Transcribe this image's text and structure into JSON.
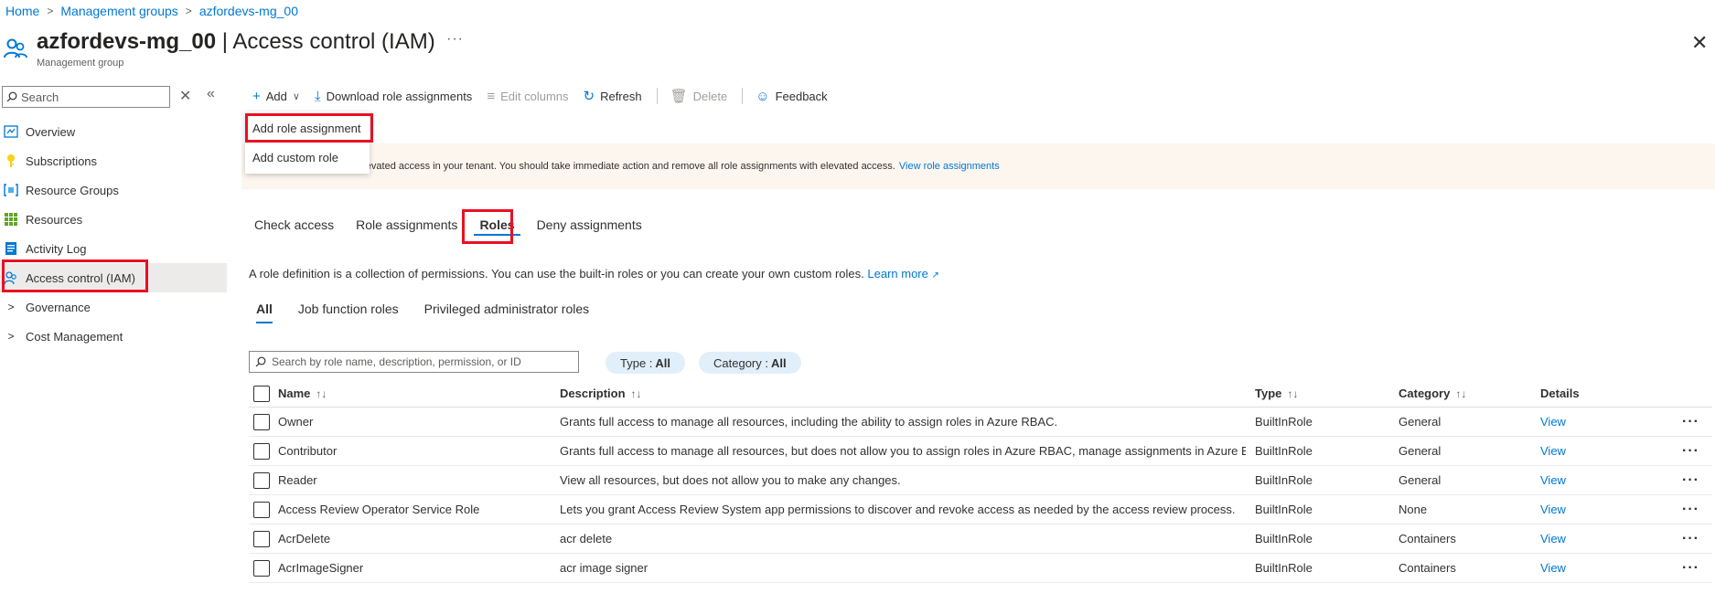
{
  "breadcrumb": {
    "items": [
      "Home",
      "Management groups",
      "azfordevs-mg_00"
    ]
  },
  "header": {
    "title_resource": "azfordevs-mg_00",
    "title_separator": " | ",
    "title_page": "Access control (IAM)",
    "subtitle": "Management group",
    "more": "···",
    "close": "✕"
  },
  "sidebar": {
    "search_placeholder": "Search",
    "items": [
      {
        "label": "Overview",
        "icon": "overview-icon"
      },
      {
        "label": "Subscriptions",
        "icon": "key-icon"
      },
      {
        "label": "Resource Groups",
        "icon": "resource-group-icon"
      },
      {
        "label": "Resources",
        "icon": "grid-icon"
      },
      {
        "label": "Activity Log",
        "icon": "log-icon"
      },
      {
        "label": "Access control (IAM)",
        "icon": "people-icon",
        "active": true
      },
      {
        "label": "Governance",
        "icon": "chevron-right-icon"
      },
      {
        "label": "Cost Management",
        "icon": "chevron-right-icon"
      }
    ]
  },
  "toolbar": {
    "add": "Add",
    "download": "Download role assignments",
    "edit_columns": "Edit columns",
    "refresh": "Refresh",
    "delete": "Delete",
    "feedback": "Feedback"
  },
  "dropdown": {
    "add_role_assignment": "Add role assignment",
    "add_custom_role": "Add custom role"
  },
  "banner": {
    "text": "user has elevated access in your tenant. You should take immediate action and remove all role assignments with elevated access.",
    "link": "View role assignments"
  },
  "tabs": [
    "Check access",
    "Role assignments",
    "Roles",
    "Deny assignments"
  ],
  "description": {
    "text": "A role definition is a collection of permissions. You can use the built-in roles or you can create your own custom roles.",
    "link": "Learn more"
  },
  "subtabs": [
    "All",
    "Job function roles",
    "Privileged administrator roles"
  ],
  "role_search_placeholder": "Search by role name, description, permission, or ID",
  "filters": {
    "type_label": "Type :",
    "type_value": "All",
    "category_label": "Category :",
    "category_value": "All"
  },
  "table": {
    "headers": {
      "name": "Name",
      "description": "Description",
      "type": "Type",
      "category": "Category",
      "details": "Details"
    },
    "rows": [
      {
        "name": "Owner",
        "description": "Grants full access to manage all resources, including the ability to assign roles in Azure RBAC.",
        "type": "BuiltInRole",
        "category": "General",
        "details": "View"
      },
      {
        "name": "Contributor",
        "description": "Grants full access to manage all resources, but does not allow you to assign roles in Azure RBAC, manage assignments in Azure B...",
        "type": "BuiltInRole",
        "category": "General",
        "details": "View"
      },
      {
        "name": "Reader",
        "description": "View all resources, but does not allow you to make any changes.",
        "type": "BuiltInRole",
        "category": "General",
        "details": "View"
      },
      {
        "name": "Access Review Operator Service Role",
        "description": "Lets you grant Access Review System app permissions to discover and revoke access as needed by the access review process.",
        "type": "BuiltInRole",
        "category": "None",
        "details": "View"
      },
      {
        "name": "AcrDelete",
        "description": "acr delete",
        "type": "BuiltInRole",
        "category": "Containers",
        "details": "View"
      },
      {
        "name": "AcrImageSigner",
        "description": "acr image signer",
        "type": "BuiltInRole",
        "category": "Containers",
        "details": "View"
      }
    ]
  },
  "colors": {
    "accent": "#0078d4",
    "highlight": "#e81123",
    "banner_bg": "#fdf6ef",
    "pill_bg": "#e1effa"
  }
}
